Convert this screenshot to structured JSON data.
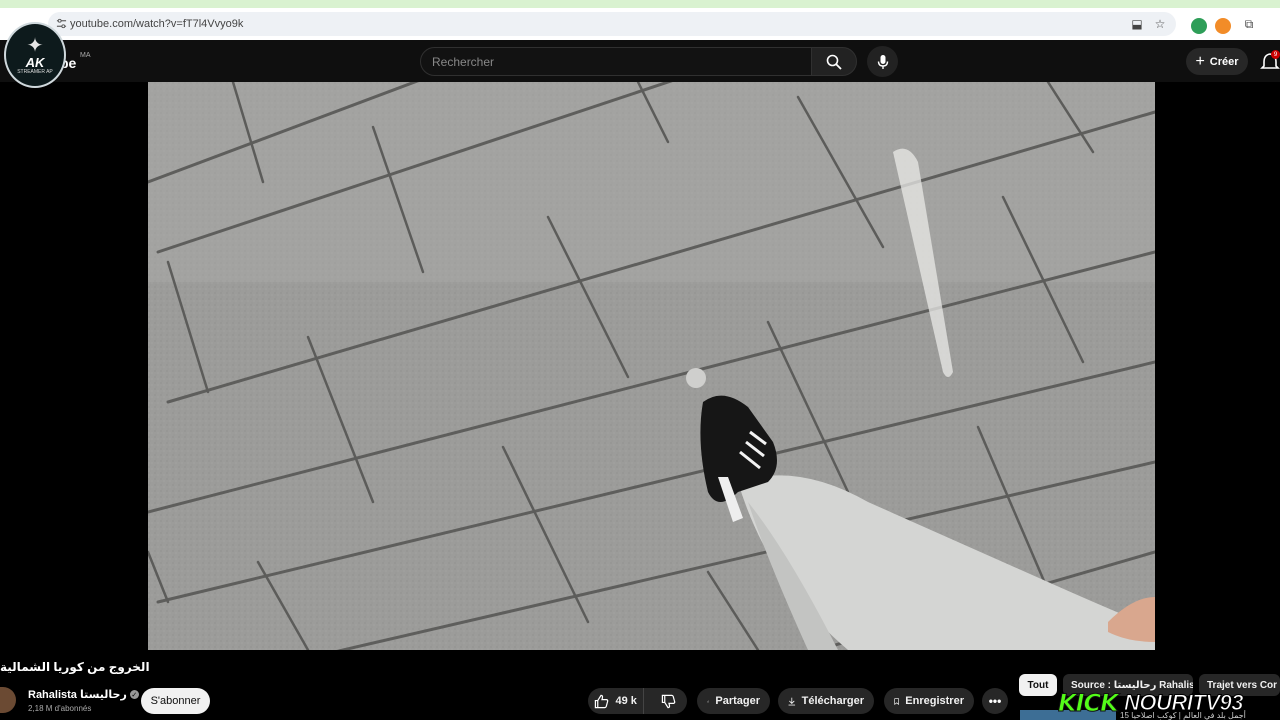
{
  "browser": {
    "url": "youtube.com/watch?v=fT7l4Vvyo9k"
  },
  "header": {
    "logo_text": "AK",
    "logo_subtext": "STREAMER AP",
    "yt_word": "be",
    "region": "MA",
    "search_placeholder": "Rechercher",
    "create_label": "Créer",
    "notifications_count": "9"
  },
  "video": {
    "title": "الخروج من كوريا الشمالية !! KP"
  },
  "channel": {
    "name": "Rahalista رحاليستا",
    "subscribers": "2,18 M d'abonnés",
    "subscribe_label": "S'abonner"
  },
  "actions": {
    "likes": "49 k",
    "share": "Partager",
    "download": "Télécharger",
    "save": "Enregistrer",
    "more": "•••"
  },
  "chips": [
    {
      "label": "Tout",
      "active": true
    },
    {
      "label": "Source : رحاليستا Rahalista",
      "active": false
    },
    {
      "label": "Trajet vers Cor",
      "active": false
    }
  ],
  "overlay": {
    "kick": "KICK",
    "username": "NOURITV93",
    "thumb_caption": "أجمل بلد في العالم | كوكب اصلاحيا 15"
  },
  "colors": {
    "background": "#0f0f0f",
    "kick_green": "#53fc18",
    "chip_bg": "#272727"
  }
}
